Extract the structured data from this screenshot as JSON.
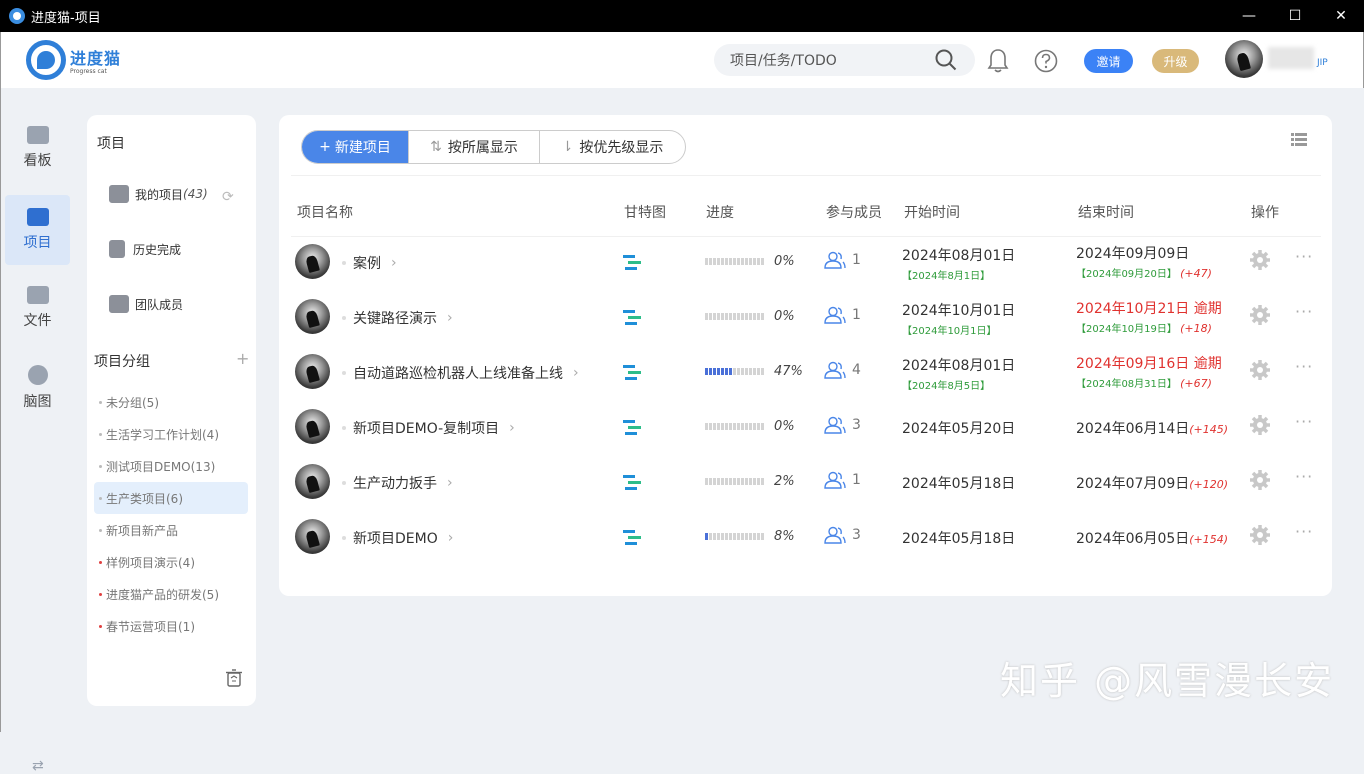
{
  "window": {
    "title": "进度猫-项目",
    "minimize": "—",
    "maximize": "☐",
    "close": "✕"
  },
  "header": {
    "logo_name": "进度猫",
    "logo_sub": "Progress cat",
    "search_placeholder": "项目/任务/TODO",
    "invite_label": "邀请",
    "upgrade_label": "升级",
    "user_suffix": "JIP"
  },
  "nav": [
    {
      "label": "看板",
      "icon": "chart-icon"
    },
    {
      "label": "项目",
      "icon": "layers-icon"
    },
    {
      "label": "文件",
      "icon": "folder-icon"
    },
    {
      "label": "脑图",
      "icon": "bulb-icon"
    }
  ],
  "side": {
    "title": "项目",
    "my_projects": "我的项目",
    "my_projects_count": "(43)",
    "history": "历史完成",
    "team": "团队成员",
    "group_title": "项目分组",
    "groups": [
      {
        "label": "未分组(5)",
        "dot": "#bbbbbb"
      },
      {
        "label": "生活学习工作计划(4)",
        "dot": "#bbbbbb"
      },
      {
        "label": "测试项目DEMO(13)",
        "dot": "#bbbbbb"
      },
      {
        "label": "生产类项目(6)",
        "dot": "#bbbbbb",
        "selected": true
      },
      {
        "label": "新项目新产品",
        "dot": "#bbbbbb"
      },
      {
        "label": "样例项目演示(4)",
        "dot": "#e04040"
      },
      {
        "label": "进度猫产品的研发(5)",
        "dot": "#e04040"
      },
      {
        "label": "春节运营项目(1)",
        "dot": "#e04040"
      }
    ]
  },
  "toolbar": {
    "new_project": "新建项目",
    "new_prefix": "+",
    "by_owner": "按所属显示",
    "by_priority": "按优先级显示"
  },
  "table": {
    "headers": {
      "name": "项目名称",
      "gantt": "甘特图",
      "progress": "进度",
      "members": "参与成员",
      "start": "开始时间",
      "end": "结束时间",
      "actions": "操作"
    },
    "rows": [
      {
        "name": "案例",
        "progress": 0,
        "progress_text": "0%",
        "members": "1",
        "start": "2024年08月01日",
        "start_sub": "【2024年8月1日】",
        "end": "2024年09月09日",
        "end_sub": "【2024年09月20日】",
        "end_plus": "(+47)",
        "late": false
      },
      {
        "name": "关键路径演示",
        "progress": 0,
        "progress_text": "0%",
        "members": "1",
        "start": "2024年10月01日",
        "start_sub": "【2024年10月1日】",
        "end": "2024年10月21日 逾期",
        "end_sub": "【2024年10月19日】",
        "end_plus": "(+18)",
        "late": true
      },
      {
        "name": "自动道路巡检机器人上线准备上线",
        "progress": 0.47,
        "progress_text": "47%",
        "members": "4",
        "start": "2024年08月01日",
        "start_sub": "【2024年8月5日】",
        "end": "2024年09月16日 逾期",
        "end_sub": "【2024年08月31日】",
        "end_plus": "(+67)",
        "late": true
      },
      {
        "name": "新项目DEMO-复制项目",
        "progress": 0,
        "progress_text": "0%",
        "members": "3",
        "start": "2024年05月20日",
        "start_sub": "",
        "end": "2024年06月14日",
        "end_sub": "",
        "end_plus": "(+145)",
        "late": false
      },
      {
        "name": "生产动力扳手",
        "progress": 0.02,
        "progress_text": "2%",
        "members": "1",
        "start": "2024年05月18日",
        "start_sub": "",
        "end": "2024年07月09日",
        "end_sub": "",
        "end_plus": "(+120)",
        "late": false
      },
      {
        "name": "新项目DEMO",
        "progress": 0.08,
        "progress_text": "8%",
        "members": "3",
        "start": "2024年05月18日",
        "start_sub": "",
        "end": "2024年06月05日",
        "end_sub": "",
        "end_plus": "(+154)",
        "late": false
      }
    ]
  },
  "watermark": "知乎 @风雪漫长安",
  "colors": {
    "accent": "#4a86e8",
    "late": "#e0322f",
    "green": "#2e9b3a"
  }
}
